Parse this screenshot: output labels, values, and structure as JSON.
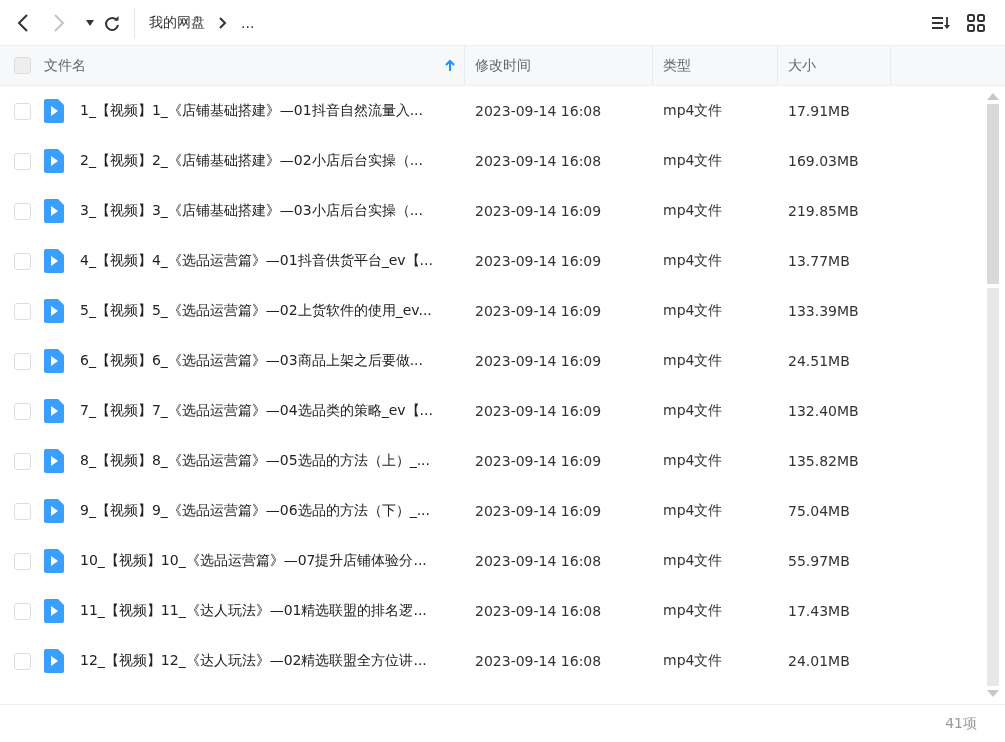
{
  "toolbar": {
    "back": {
      "disabled": false
    },
    "forward": {
      "disabled": true
    },
    "breadcrumb": [
      {
        "label": "我的网盘"
      },
      {
        "label": "..."
      }
    ]
  },
  "table": {
    "select_all": {
      "checked": false
    },
    "columns": [
      {
        "label": "文件名",
        "sorted": true
      },
      {
        "label": "修改时间",
        "sorted": false
      },
      {
        "label": "类型",
        "sorted": false
      },
      {
        "label": "大小",
        "sorted": false
      }
    ],
    "rows": [
      {
        "name": "1_【视频】1_《店铺基础搭建》—01抖音自然流量入...",
        "modified": "2023-09-14 16:08",
        "type": "mp4文件",
        "size": "17.91MB",
        "checked": false
      },
      {
        "name": "2_【视频】2_《店铺基础搭建》—02小店后台实操（...",
        "modified": "2023-09-14 16:08",
        "type": "mp4文件",
        "size": "169.03MB",
        "checked": false
      },
      {
        "name": "3_【视频】3_《店铺基础搭建》—03小店后台实操（...",
        "modified": "2023-09-14 16:09",
        "type": "mp4文件",
        "size": "219.85MB",
        "checked": false
      },
      {
        "name": "4_【视频】4_《选品运营篇》—01抖音供货平台_ev【...",
        "modified": "2023-09-14 16:09",
        "type": "mp4文件",
        "size": "13.77MB",
        "checked": false
      },
      {
        "name": "5_【视频】5_《选品运营篇》—02上货软件的使用_ev...",
        "modified": "2023-09-14 16:09",
        "type": "mp4文件",
        "size": "133.39MB",
        "checked": false
      },
      {
        "name": "6_【视频】6_《选品运营篇》—03商品上架之后要做...",
        "modified": "2023-09-14 16:09",
        "type": "mp4文件",
        "size": "24.51MB",
        "checked": false
      },
      {
        "name": "7_【视频】7_《选品运营篇》—04选品类的策略_ev【...",
        "modified": "2023-09-14 16:09",
        "type": "mp4文件",
        "size": "132.40MB",
        "checked": false
      },
      {
        "name": "8_【视频】8_《选品运营篇》—05选品的方法（上）_...",
        "modified": "2023-09-14 16:09",
        "type": "mp4文件",
        "size": "135.82MB",
        "checked": false
      },
      {
        "name": "9_【视频】9_《选品运营篇》—06选品的方法（下）_...",
        "modified": "2023-09-14 16:09",
        "type": "mp4文件",
        "size": "75.04MB",
        "checked": false
      },
      {
        "name": "10_【视频】10_《选品运营篇》—07提升店铺体验分...",
        "modified": "2023-09-14 16:08",
        "type": "mp4文件",
        "size": "55.97MB",
        "checked": false
      },
      {
        "name": "11_【视频】11_《达人玩法》—01精选联盟的排名逻...",
        "modified": "2023-09-14 16:08",
        "type": "mp4文件",
        "size": "17.43MB",
        "checked": false
      },
      {
        "name": "12_【视频】12_《达人玩法》—02精选联盟全方位讲...",
        "modified": "2023-09-14 16:08",
        "type": "mp4文件",
        "size": "24.01MB",
        "checked": false
      }
    ]
  },
  "status_bar": {
    "count": "41项"
  }
}
